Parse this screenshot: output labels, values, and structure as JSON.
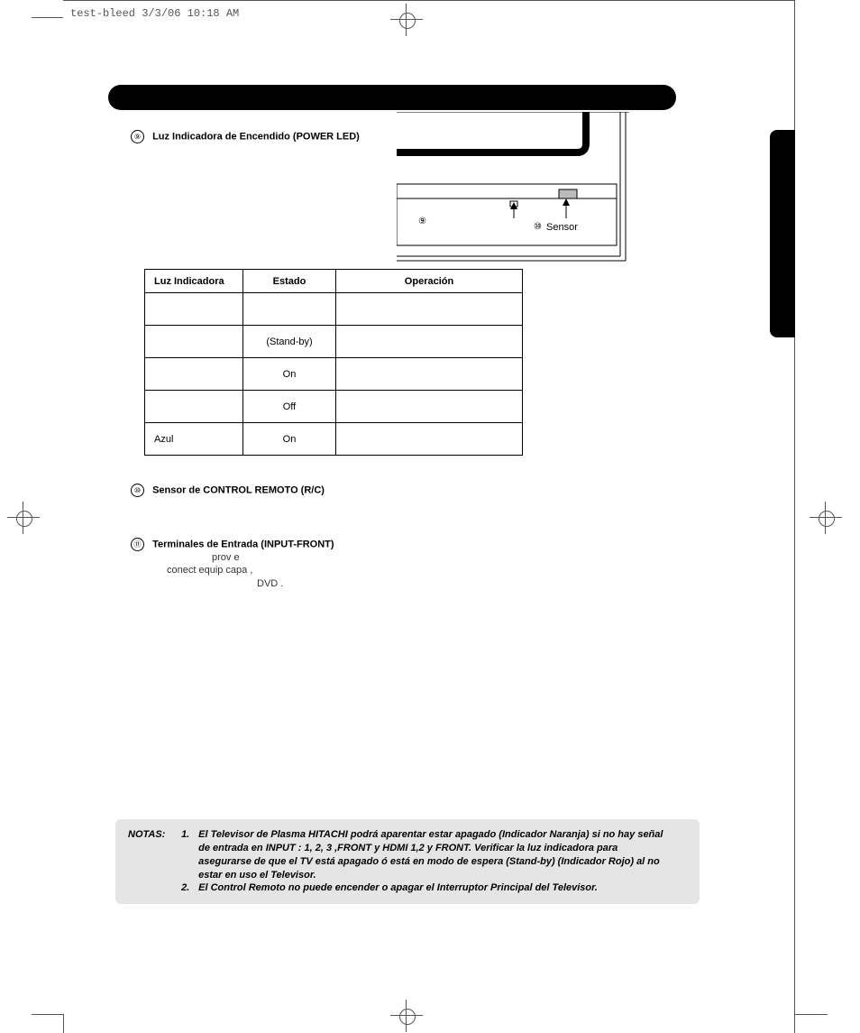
{
  "header": {
    "slug": "test-bleed  3/3/06  10:18 AM"
  },
  "diagram": {
    "marker9": "⑨",
    "marker10": "⑩",
    "sensorLabel": "Sensor"
  },
  "section9": {
    "num": "⑨",
    "title": "Luz Indicadora de Encendido (POWER LED)"
  },
  "table": {
    "headers": {
      "c1": "Luz Indicadora",
      "c2": "Estado",
      "c3": "Operación"
    },
    "rows": [
      {
        "c1": "",
        "c2": "",
        "c3": ""
      },
      {
        "c1": "",
        "c2": "(Stand-by)",
        "c3": ""
      },
      {
        "c1": "",
        "c2": "On",
        "c3": ""
      },
      {
        "c1": "",
        "c2": "Off",
        "c3": ""
      },
      {
        "c1": "Azul",
        "c2": "On",
        "c3": ""
      }
    ]
  },
  "section10": {
    "num": "⑩",
    "title": "Sensor de CONTROL REMOTO (R/C)"
  },
  "section11": {
    "num": "⑪",
    "title": "Terminales de Entrada  (INPUT-FRONT)",
    "line1": "prov  e",
    "line2": "conect    equip            capa       ,",
    "line3": "DVD                  ."
  },
  "notes": {
    "label": "NOTAS:",
    "n1num": "1.",
    "n1": "El Televisor de Plasma HITACHI podrá aparentar estar apagado (Indicador Naranja) si no hay señal de entrada en INPUT : 1, 2, 3 ,FRONT y HDMI 1,2 y FRONT.  Verificar la luz indicadora para asegurarse de que el TV está apagado ó está en modo de espera (Stand-by) (Indicador Rojo) al no estar en uso el Televisor.",
    "n2num": "2.",
    "n2": "El Control Remoto no puede encender o apagar el Interruptor Principal del Televisor."
  }
}
